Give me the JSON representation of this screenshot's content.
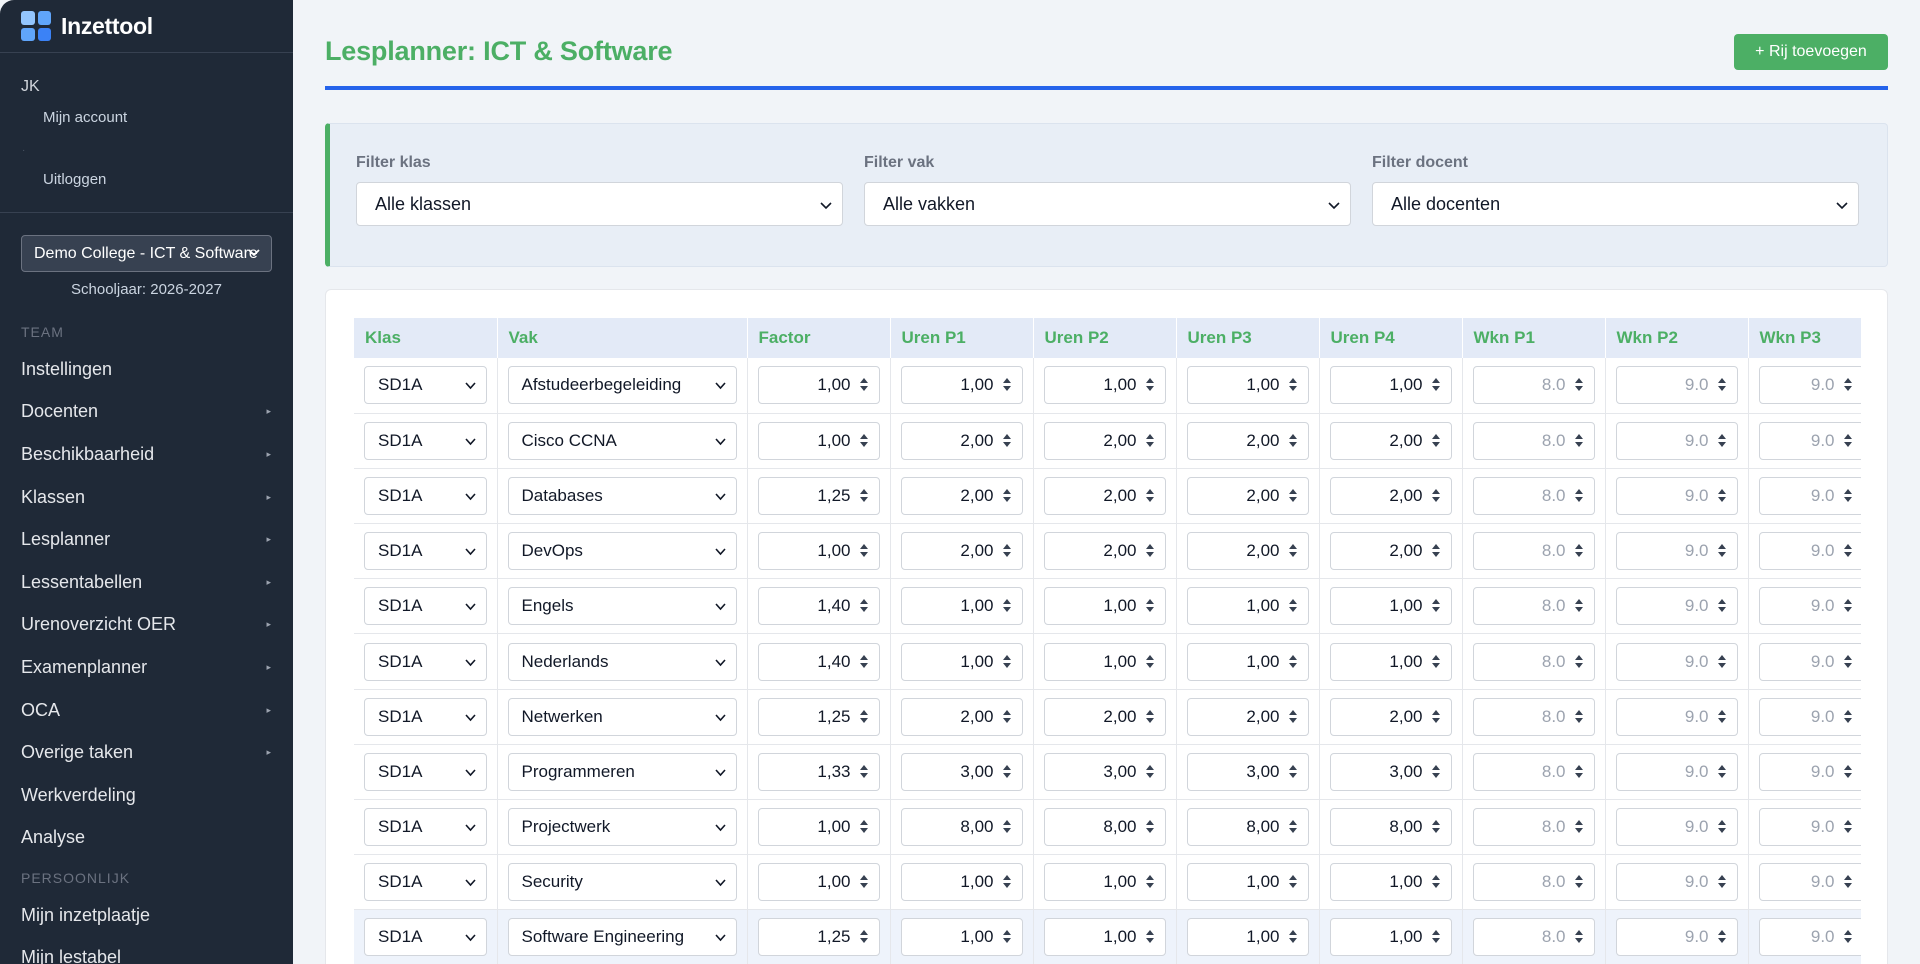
{
  "sidebar": {
    "brand": "Inzettool",
    "user": {
      "initials": "JK",
      "account_link": "Mijn account",
      "logout_link": "Uitloggen"
    },
    "school_select": "Demo College - ICT & Software",
    "school_year": "Schooljaar: 2026-2027",
    "section_team": "TEAM",
    "team_items": [
      {
        "label": "Instellingen",
        "caret": false
      },
      {
        "label": "Docenten",
        "caret": true
      },
      {
        "label": "Beschikbaarheid",
        "caret": true
      },
      {
        "label": "Klassen",
        "caret": true
      },
      {
        "label": "Lesplanner",
        "caret": true
      },
      {
        "label": "Lessentabellen",
        "caret": true
      },
      {
        "label": "Urenoverzicht OER",
        "caret": true
      },
      {
        "label": "Examenplanner",
        "caret": true
      },
      {
        "label": "OCA",
        "caret": true
      },
      {
        "label": "Overige taken",
        "caret": true
      },
      {
        "label": "Werkverdeling",
        "caret": false
      },
      {
        "label": "Analyse",
        "caret": false
      }
    ],
    "section_personal": "PERSOONLIJK",
    "personal_items": [
      {
        "label": "Mijn inzetplaatje"
      },
      {
        "label": "Mijn lestabel"
      }
    ],
    "caret_glyph": "▸"
  },
  "header": {
    "title": "Lesplanner: ICT & Software",
    "add_button": "+ Rij toevoegen"
  },
  "filters": {
    "klas": {
      "label": "Filter klas",
      "value": "Alle klassen"
    },
    "vak": {
      "label": "Filter vak",
      "value": "Alle vakken"
    },
    "docent": {
      "label": "Filter docent",
      "value": "Alle docenten"
    }
  },
  "table": {
    "columns": [
      "Klas",
      "Vak",
      "Factor",
      "Uren P1",
      "Uren P2",
      "Uren P3",
      "Uren P4",
      "Wkn P1",
      "Wkn P2",
      "Wkn P3"
    ],
    "rows": [
      {
        "klas": "SD1A",
        "vak": "Afstudeerbegeleiding",
        "factor": "1,00",
        "u1": "1,00",
        "u2": "1,00",
        "u3": "1,00",
        "u4": "1,00",
        "w1": "8.0",
        "w2": "9.0",
        "w3": "9.0"
      },
      {
        "klas": "SD1A",
        "vak": "Cisco CCNA",
        "factor": "1,00",
        "u1": "2,00",
        "u2": "2,00",
        "u3": "2,00",
        "u4": "2,00",
        "w1": "8.0",
        "w2": "9.0",
        "w3": "9.0"
      },
      {
        "klas": "SD1A",
        "vak": "Databases",
        "factor": "1,25",
        "u1": "2,00",
        "u2": "2,00",
        "u3": "2,00",
        "u4": "2,00",
        "w1": "8.0",
        "w2": "9.0",
        "w3": "9.0"
      },
      {
        "klas": "SD1A",
        "vak": "DevOps",
        "factor": "1,00",
        "u1": "2,00",
        "u2": "2,00",
        "u3": "2,00",
        "u4": "2,00",
        "w1": "8.0",
        "w2": "9.0",
        "w3": "9.0"
      },
      {
        "klas": "SD1A",
        "vak": "Engels",
        "factor": "1,40",
        "u1": "1,00",
        "u2": "1,00",
        "u3": "1,00",
        "u4": "1,00",
        "w1": "8.0",
        "w2": "9.0",
        "w3": "9.0"
      },
      {
        "klas": "SD1A",
        "vak": "Nederlands",
        "factor": "1,40",
        "u1": "1,00",
        "u2": "1,00",
        "u3": "1,00",
        "u4": "1,00",
        "w1": "8.0",
        "w2": "9.0",
        "w3": "9.0"
      },
      {
        "klas": "SD1A",
        "vak": "Netwerken",
        "factor": "1,25",
        "u1": "2,00",
        "u2": "2,00",
        "u3": "2,00",
        "u4": "2,00",
        "w1": "8.0",
        "w2": "9.0",
        "w3": "9.0"
      },
      {
        "klas": "SD1A",
        "vak": "Programmeren",
        "factor": "1,33",
        "u1": "3,00",
        "u2": "3,00",
        "u3": "3,00",
        "u4": "3,00",
        "w1": "8.0",
        "w2": "9.0",
        "w3": "9.0"
      },
      {
        "klas": "SD1A",
        "vak": "Projectwerk",
        "factor": "1,00",
        "u1": "8,00",
        "u2": "8,00",
        "u3": "8,00",
        "u4": "8,00",
        "w1": "8.0",
        "w2": "9.0",
        "w3": "9.0"
      },
      {
        "klas": "SD1A",
        "vak": "Security",
        "factor": "1,00",
        "u1": "1,00",
        "u2": "1,00",
        "u3": "1,00",
        "u4": "1,00",
        "w1": "8.0",
        "w2": "9.0",
        "w3": "9.0"
      },
      {
        "klas": "SD1A",
        "vak": "Software Engineering",
        "factor": "1,25",
        "u1": "1,00",
        "u2": "1,00",
        "u3": "1,00",
        "u4": "1,00",
        "w1": "8.0",
        "w2": "9.0",
        "w3": "9.0",
        "highlighted": true
      }
    ]
  },
  "icons": {
    "dropdown": "chevron-down-icon",
    "spinner": "number-spinner-icon",
    "logo": "grid-logo-icon"
  },
  "colors": {
    "accent_green": "#4caf65",
    "accent_blue": "#2563eb",
    "sidebar_bg": "#1f2937"
  }
}
